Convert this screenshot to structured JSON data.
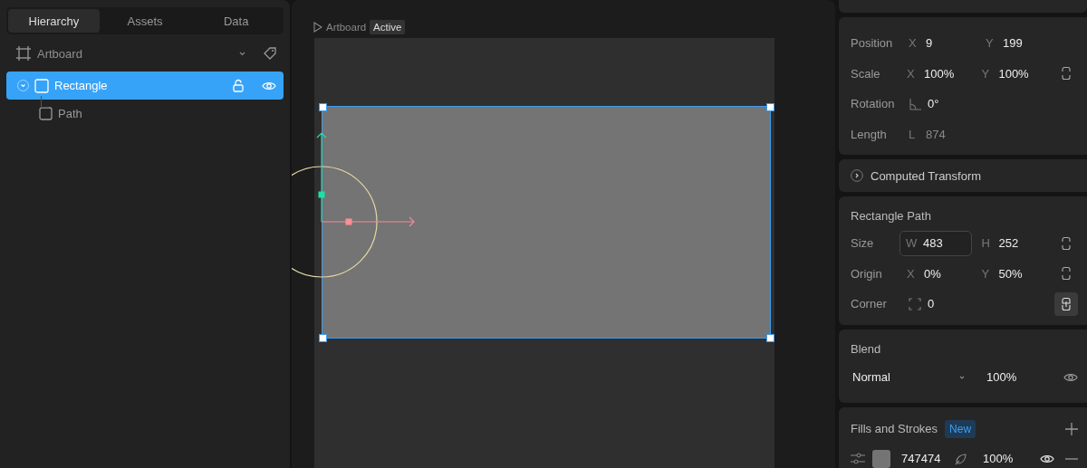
{
  "tabs": [
    {
      "label": "Hierarchy",
      "selected": true
    },
    {
      "label": "Assets",
      "selected": false
    },
    {
      "label": "Data",
      "selected": false
    }
  ],
  "hierarchy": {
    "artboard": "Artboard",
    "items": [
      {
        "label": "Rectangle",
        "selected": true,
        "expanded": true,
        "locked": false,
        "visible": true,
        "children": [
          {
            "label": "Path",
            "selected": false
          }
        ]
      }
    ]
  },
  "canvas": {
    "artboard_label": "Artboard",
    "state_badge": "Active"
  },
  "transform": {
    "rows": [
      {
        "label": "Position",
        "kind": "plain",
        "fields": [
          {
            "kind": "axis",
            "prefix": "X",
            "value": "9",
            "focused": false,
            "disabled": false
          },
          {
            "kind": "axis",
            "prefix": "Y",
            "value": "199",
            "focused": false,
            "disabled": false
          }
        ]
      },
      {
        "label": "Scale",
        "kind": "linked",
        "fields": [
          {
            "kind": "axis",
            "prefix": "X",
            "value": "100%",
            "focused": false,
            "disabled": false
          },
          {
            "kind": "axis",
            "prefix": "Y",
            "value": "100%",
            "focused": false,
            "disabled": false
          }
        ]
      },
      {
        "label": "Rotation",
        "kind": "plain",
        "fields": [
          {
            "kind": "angle",
            "value": "0°",
            "focused": false,
            "disabled": false
          }
        ]
      },
      {
        "label": "Length",
        "kind": "plain",
        "fields": [
          {
            "kind": "axis",
            "prefix": "L",
            "value": "874",
            "focused": false,
            "disabled": true
          }
        ]
      }
    ]
  },
  "computed_transform": {
    "title": "Computed Transform",
    "expanded": false
  },
  "rectangle_path": {
    "title": "Rectangle Path",
    "rows": [
      {
        "label": "Size",
        "kind": "linked",
        "fields": [
          {
            "kind": "axis",
            "prefix": "W",
            "value": "483",
            "focused": true,
            "disabled": false
          },
          {
            "kind": "axis",
            "prefix": "H",
            "value": "252",
            "focused": false,
            "disabled": false
          }
        ]
      },
      {
        "label": "Origin",
        "kind": "linked",
        "fields": [
          {
            "kind": "axis",
            "prefix": "X",
            "value": "0%",
            "focused": false,
            "disabled": false
          },
          {
            "kind": "axis",
            "prefix": "Y",
            "value": "50%",
            "focused": false,
            "disabled": false
          }
        ]
      },
      {
        "label": "Corner",
        "kind": "toggle",
        "fields": [
          {
            "kind": "corner",
            "value": "0",
            "focused": false,
            "disabled": false
          }
        ]
      }
    ]
  },
  "blend": {
    "title": "Blend",
    "mode": "Normal",
    "opacity": "100%",
    "visible": true
  },
  "fills_and_strokes": {
    "title": "Fills and Strokes",
    "badge": "New",
    "fills": [
      {
        "color": "#747474",
        "hex": "747474",
        "opacity": "100%",
        "visible": true
      }
    ]
  }
}
